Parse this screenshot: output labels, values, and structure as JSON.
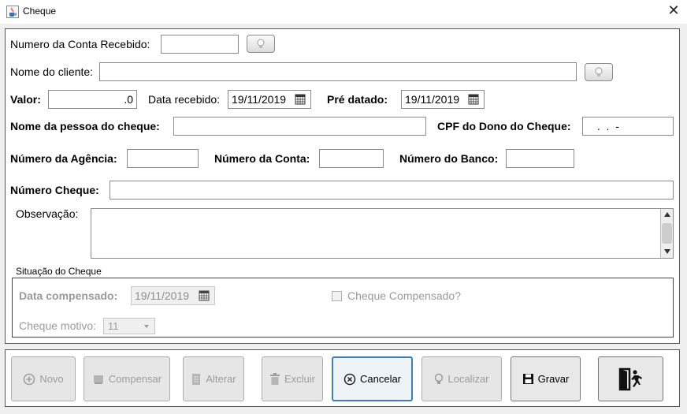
{
  "window": {
    "title": "Cheque",
    "close_glyph": "✕"
  },
  "form": {
    "conta_recebido": {
      "label": "Numero da Conta Recebido:",
      "value": ""
    },
    "nome_cliente": {
      "label": "Nome do cliente:",
      "value": ""
    },
    "valor": {
      "label": "Valor:",
      "value": ".0"
    },
    "data_recebido": {
      "label": "Data recebido:",
      "value": "19/11/2019"
    },
    "pre_datado": {
      "label": "Pré datado:",
      "value": "19/11/2019"
    },
    "nome_pessoa": {
      "label": "Nome da pessoa do cheque:",
      "value": ""
    },
    "cpf_dono": {
      "label": "CPF do Dono do Cheque:",
      "value": " .  .  -"
    },
    "numero_agencia": {
      "label": "Número da Agência:",
      "value": ""
    },
    "numero_conta": {
      "label": "Número da Conta:",
      "value": ""
    },
    "numero_banco": {
      "label": "Número do Banco:",
      "value": ""
    },
    "numero_cheque": {
      "label": "Número Cheque:",
      "value": ""
    },
    "observacao": {
      "label": "Observação:",
      "value": ""
    }
  },
  "situacao": {
    "title": "Situação do Cheque",
    "data_compensado": {
      "label": "Data compensado:",
      "value": "19/11/2019"
    },
    "cheque_compensado": {
      "label": "Cheque Compensado?",
      "checked": false
    },
    "cheque_motivo": {
      "label": "Cheque motivo:",
      "value": "11"
    }
  },
  "buttons": {
    "novo": "Novo",
    "compensar": "Compensar",
    "alterar": "Alterar",
    "excluir": "Excluir",
    "cancelar": "Cancelar",
    "localizar": "Localizar",
    "gravar": "Gravar"
  },
  "icons": {
    "app": "java-cup-icon",
    "lookup": "bulb-icon",
    "calendar": "calendar-icon",
    "novo": "plus-circle-icon",
    "compensar": "stamp-icon",
    "alterar": "document-edit-icon",
    "excluir": "trash-icon",
    "cancelar": "x-circle-icon",
    "localizar": "bulb-icon",
    "gravar": "floppy-disk-icon",
    "sair": "exit-door-icon"
  },
  "colors": {
    "focus_border": "#3c7fb1",
    "disabled_text": "#9c9c9c"
  }
}
